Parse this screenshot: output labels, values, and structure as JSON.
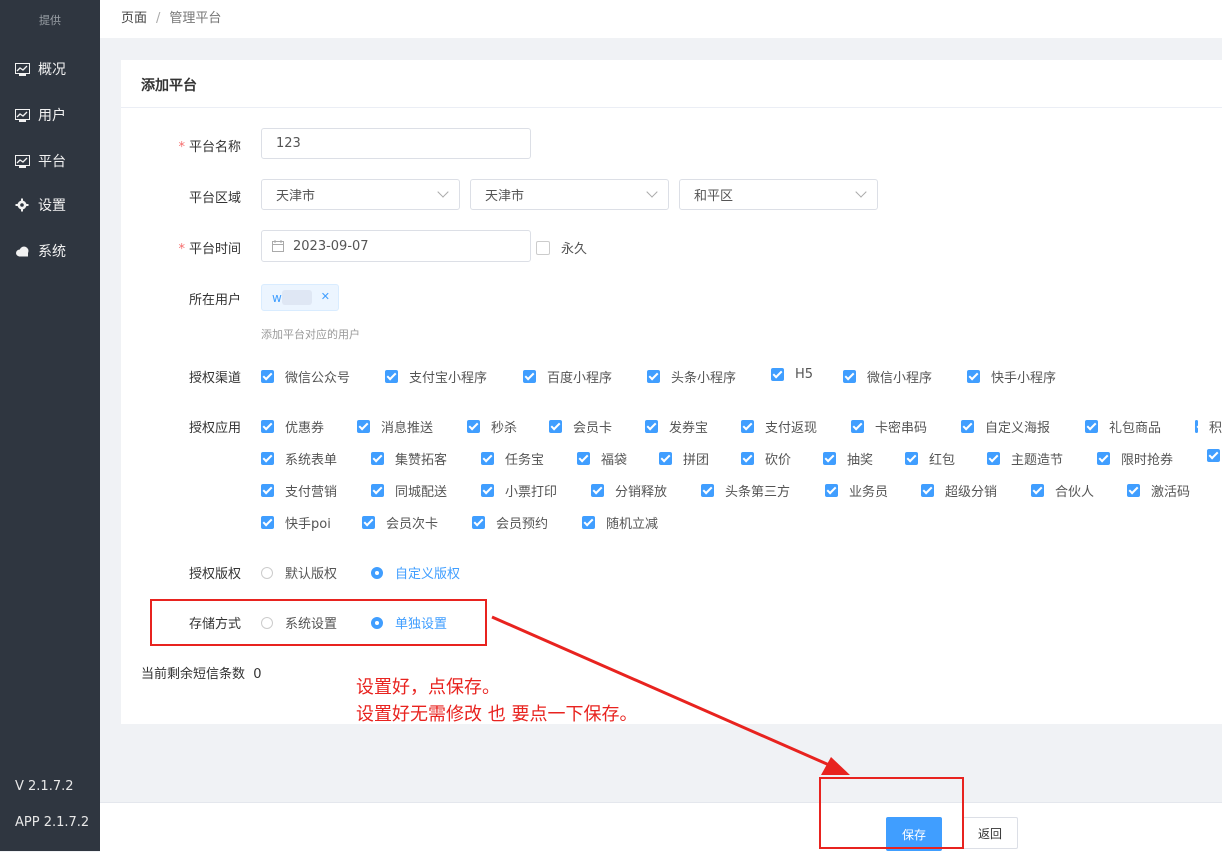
{
  "sidebar": {
    "logo": "提供",
    "items": [
      {
        "label": "概况",
        "icon": "chart-icon"
      },
      {
        "label": "用户",
        "icon": "chart-icon"
      },
      {
        "label": "平台",
        "icon": "chart-icon"
      },
      {
        "label": "设置",
        "icon": "gear-icon"
      },
      {
        "label": "系统",
        "icon": "cloud-icon"
      }
    ],
    "version": "V 2.1.7.2",
    "app_version": "APP 2.1.7.2"
  },
  "breadcrumb": {
    "root": "页面",
    "sep": "/",
    "current": "管理平台"
  },
  "card": {
    "title": "添加平台"
  },
  "form": {
    "name": {
      "label": "平台名称",
      "value": "123"
    },
    "region": {
      "label": "平台区域",
      "province": "天津市",
      "city": "天津市",
      "district": "和平区"
    },
    "time": {
      "label": "平台时间",
      "value": "2023-09-07",
      "forever_label": "永久"
    },
    "users": {
      "label": "所在用户",
      "tag": "w",
      "hint": "添加平台对应的用户"
    },
    "channels": {
      "label": "授权渠道",
      "items": [
        "微信公众号",
        "支付宝小程序",
        "百度小程序",
        "头条小程序",
        "H5",
        "微信小程序",
        "快手小程序"
      ]
    },
    "apps": {
      "label": "授权应用",
      "rows": [
        [
          "优惠券",
          "消息推送",
          "秒杀",
          "会员卡",
          "发券宝",
          "支付返现",
          "卡密串码",
          "自定义海报",
          "礼包商品",
          "积"
        ],
        [
          "系统表单",
          "集赞拓客",
          "任务宝",
          "福袋",
          "拼团",
          "砍价",
          "抽奖",
          "红包",
          "主题造节",
          "限时抢券",
          ""
        ],
        [
          "支付营销",
          "同城配送",
          "小票打印",
          "分销释放",
          "头条第三方",
          "业务员",
          "超级分销",
          "合伙人",
          "激活码"
        ],
        [
          "快手poi",
          "会员次卡",
          "会员预约",
          "随机立减"
        ]
      ]
    },
    "copyright": {
      "label": "授权版权",
      "options": [
        "默认版权",
        "自定义版权"
      ],
      "selected": 1
    },
    "storage": {
      "label": "存储方式",
      "options": [
        "系统设置",
        "单独设置"
      ],
      "selected": 1
    },
    "sms": {
      "label": "当前剩余短信条数",
      "value": "0"
    }
  },
  "annotation": {
    "line1": "设置好，点保存。",
    "line2": "设置好无需修改 也 要点一下保存。"
  },
  "footer": {
    "save": "保存",
    "back": "返回"
  },
  "colors": {
    "accent": "#409eff",
    "sidebar": "#2f3640",
    "annotation": "#e8231f"
  }
}
